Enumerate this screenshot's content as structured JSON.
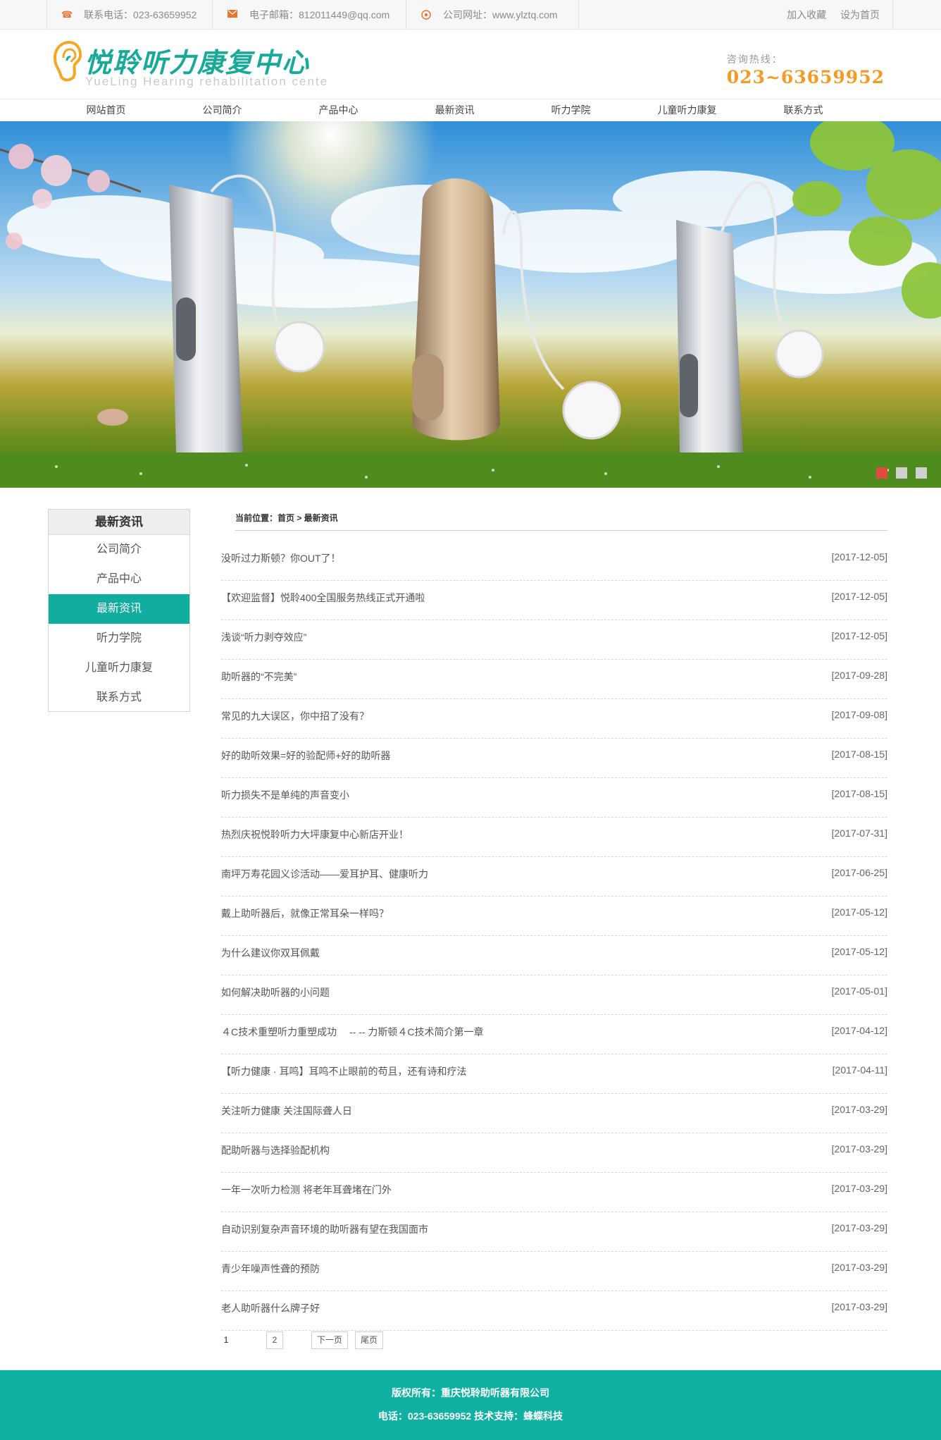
{
  "topbar": {
    "phone": "联系电话：023-63659952",
    "email": "电子邮箱：812011449@qq.com",
    "website": "公司网址：www.ylztq.com",
    "favorite": "加入收藏",
    "homepage": "设为首页"
  },
  "header": {
    "logo_cn": "悦聆听力康复中心",
    "logo_en": "YueLing Hearing rehabilitation cente",
    "hotline_label": "咨询热线：",
    "hotline_number": "023~63659952"
  },
  "nav": {
    "items": [
      "网站首页",
      "公司简介",
      "产品中心",
      "最新资讯",
      "听力学院",
      "儿童听力康复",
      "联系方式"
    ]
  },
  "sidebar": {
    "title": "最新资讯",
    "items": [
      "公司简介",
      "产品中心",
      "最新资讯",
      "听力学院",
      "儿童听力康复",
      "联系方式"
    ],
    "active_index": 2
  },
  "breadcrumb": "当前位置：首页 > 最新资讯",
  "news": [
    {
      "title": "没听过力斯顿？你OUT了！",
      "date": "[2017-12-05]"
    },
    {
      "title": "【欢迎监督】悦聆400全国服务热线正式开通啦",
      "date": "[2017-12-05]"
    },
    {
      "title": "浅谈“听力剥夺效应”",
      "date": "[2017-12-05]"
    },
    {
      "title": "助听器的“不完美”",
      "date": "[2017-09-28]"
    },
    {
      "title": "常见的九大误区，你中招了没有？",
      "date": "[2017-09-08]"
    },
    {
      "title": "好的助听效果=好的验配师+好的助听器",
      "date": "[2017-08-15]"
    },
    {
      "title": "听力损失不是单纯的声音变小",
      "date": "[2017-08-15]"
    },
    {
      "title": "热烈庆祝悦聆听力大坪康复中心新店开业！",
      "date": "[2017-07-31]"
    },
    {
      "title": "南坪万寿花园义诊活动——爱耳护耳、健康听力",
      "date": "[2017-06-25]"
    },
    {
      "title": "戴上助听器后，就像正常耳朵一样吗？",
      "date": "[2017-05-12]"
    },
    {
      "title": "为什么建议你双耳佩戴",
      "date": "[2017-05-12]"
    },
    {
      "title": "如何解决助听器的小问题",
      "date": "[2017-05-01]"
    },
    {
      "title": "４C技术重塑听力重塑成功 　-- -- 力斯顿４C技术简介第一章",
      "date": "[2017-04-12]"
    },
    {
      "title": "【听力健康 · 耳鸣】耳鸣不止眼前的苟且，还有诗和疗法",
      "date": "[2017-04-11]"
    },
    {
      "title": "关注听力健康 关注国际聋人日",
      "date": "[2017-03-29]"
    },
    {
      "title": "配助听器与选择验配机构",
      "date": "[2017-03-29]"
    },
    {
      "title": "一年一次听力检测 将老年耳聋堵在门外",
      "date": "[2017-03-29]"
    },
    {
      "title": "自动识别复杂声音环境的助听器有望在我国面市",
      "date": "[2017-03-29]"
    },
    {
      "title": "青少年噪声性聋的预防",
      "date": "[2017-03-29]"
    },
    {
      "title": "老人助听器什么牌子好",
      "date": "[2017-03-29]"
    }
  ],
  "pager": {
    "current": "1",
    "page2": "2",
    "next": "下一页",
    "last": "尾页"
  },
  "banner": {
    "slides": 3,
    "active_slide": 1
  },
  "footer": {
    "copyright": "版权所有：重庆悦聆助听器有限公司",
    "contact": "电话：023-63659952 技术支持：蜂蝶科技"
  },
  "colors": {
    "brand_teal": "#11ad9f",
    "hotline_orange": "#f59a23",
    "topbar_icon": "#e8742e"
  }
}
